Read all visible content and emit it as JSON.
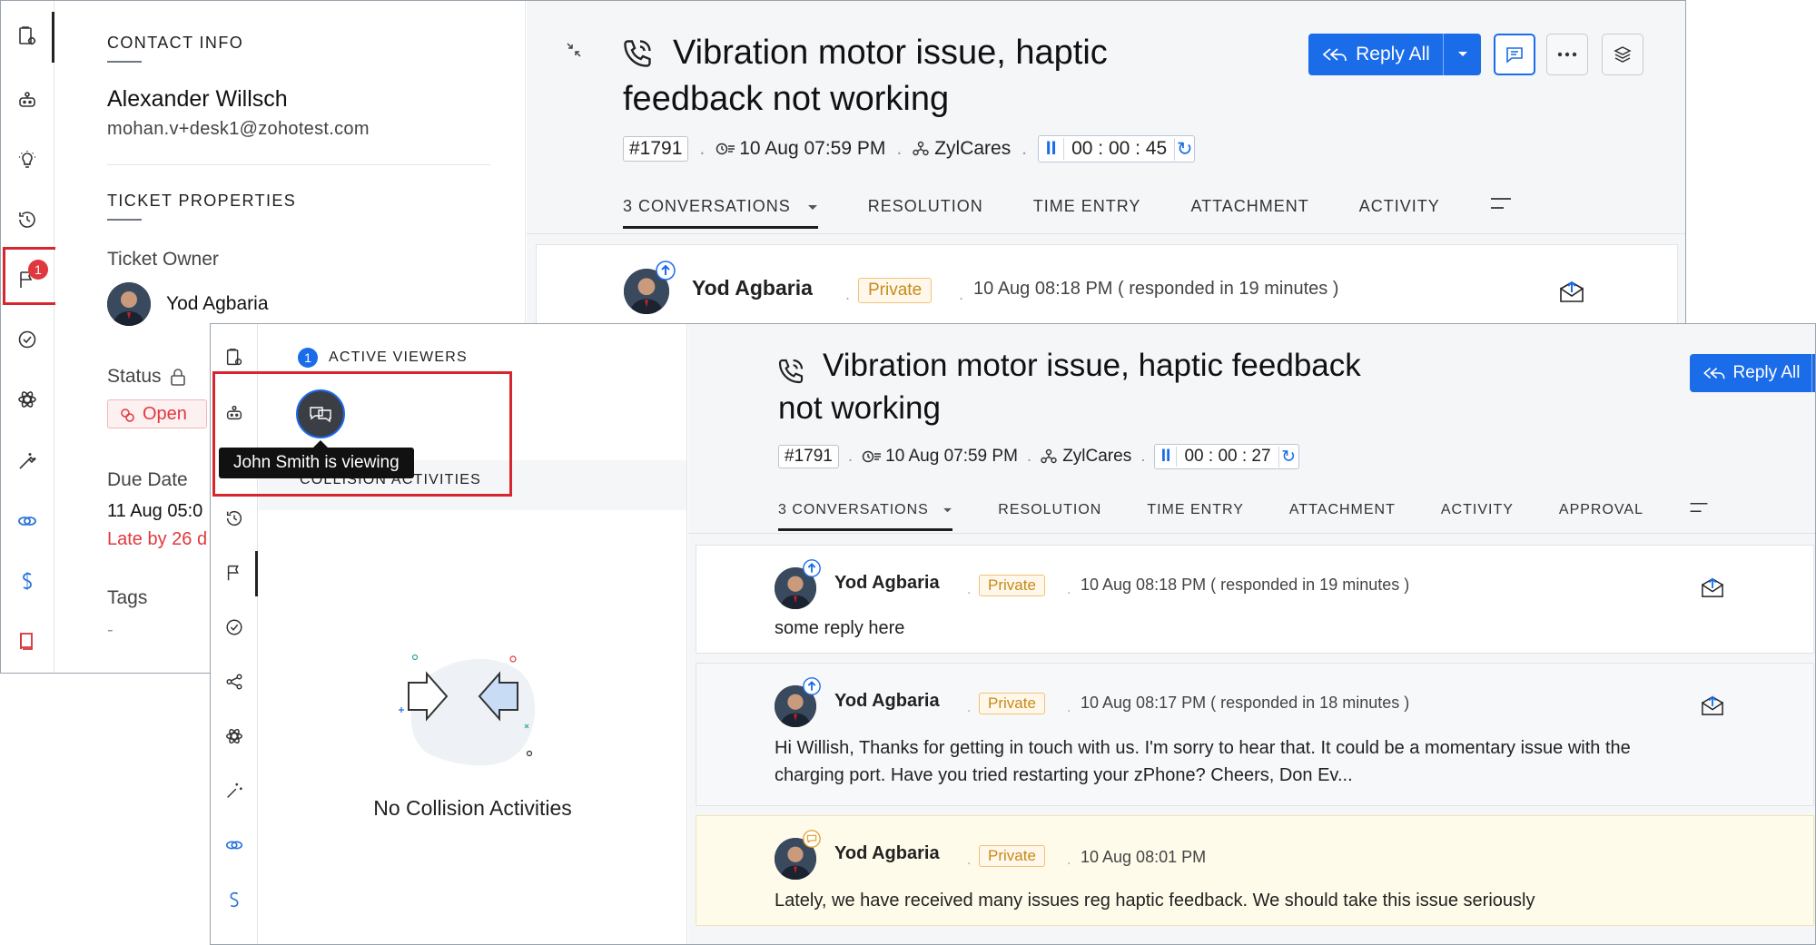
{
  "back": {
    "contact": {
      "section_title": "CONTACT INFO",
      "name": "Alexander Willsch",
      "email": "mohan.v+desk1@zohotest.com"
    },
    "ticket_props": {
      "section_title": "TICKET PROPERTIES",
      "owner_label": "Ticket Owner",
      "owner_name": "Yod Agbaria",
      "status_label": "Status",
      "status_value": "Open",
      "due_label": "Due Date",
      "due_value": "11 Aug 05:0",
      "late_text": "Late by 26 d",
      "tags_label": "Tags",
      "tags_value": "-"
    },
    "rail_badge": "1",
    "ticket": {
      "title_line1": "Vibration motor issue, haptic",
      "title_line2": "feedback not working",
      "id": "#1791",
      "created": "10 Aug 07:59 PM",
      "team": "ZylCares",
      "timer": "00 : 00 : 45",
      "reply_label": "Reply All"
    },
    "tabs": [
      "3 CONVERSATIONS",
      "RESOLUTION",
      "TIME ENTRY",
      "ATTACHMENT",
      "ACTIVITY"
    ],
    "conversation": {
      "author": "Yod Agbaria",
      "tag": "Private",
      "time": "10 Aug 08:18 PM ( responded in 19 minutes )"
    }
  },
  "front": {
    "viewers": {
      "count": "1",
      "title": "ACTIVE VIEWERS",
      "tooltip": "John Smith is viewing",
      "collision_title": "COLLISION ACTIVITIES",
      "empty_text": "No Collision Activities"
    },
    "ticket": {
      "title_line1": "Vibration motor issue, haptic feedback",
      "title_line2": "not working",
      "id": "#1791",
      "created": "10 Aug 07:59 PM",
      "team": "ZylCares",
      "timer": "00 : 00 : 27",
      "reply_label": "Reply All"
    },
    "tabs": [
      "3 CONVERSATIONS",
      "RESOLUTION",
      "TIME ENTRY",
      "ATTACHMENT",
      "ACTIVITY",
      "APPROVAL"
    ],
    "conversations": [
      {
        "author": "Yod Agbaria",
        "tag": "Private",
        "time": "10 Aug 08:18 PM ( responded in 19 minutes )",
        "body": "some reply here"
      },
      {
        "author": "Yod Agbaria",
        "tag": "Private",
        "time": "10 Aug 08:17 PM ( responded in 18 minutes )",
        "body_line1": "Hi Willish, Thanks for getting in touch with us. I'm sorry to hear that. It could be a momentary issue with the",
        "body_line2": "charging port. Have you tried restarting your zPhone? Cheers, Don Ev..."
      },
      {
        "author": "Yod Agbaria",
        "tag": "Private",
        "time": "10 Aug 08:01 PM",
        "body": "Lately, we have received many issues reg haptic feedback. We should take this issue seriously"
      }
    ]
  },
  "colors": {
    "accent": "#1a6ce8",
    "highlight_red": "#d7262f",
    "status_open": "#e0383e",
    "private_tag": "#c68a1a",
    "note_bg": "#fffbea"
  },
  "icons": {
    "rail": [
      "ticket-settings-icon",
      "bot-icon",
      "idea-bulb-icon",
      "history-icon",
      "flag-icon",
      "check-circle-icon",
      "atom-icon",
      "magic-wand-icon",
      "link-icon",
      "brand-s-icon",
      "book-icon"
    ],
    "rail_front": [
      "ticket-settings-icon",
      "bot-icon",
      "history-icon",
      "flag-icon",
      "check-circle-icon",
      "share-icon",
      "atom-icon",
      "magic-wand-icon",
      "link-icon",
      "brand-s-icon"
    ]
  }
}
